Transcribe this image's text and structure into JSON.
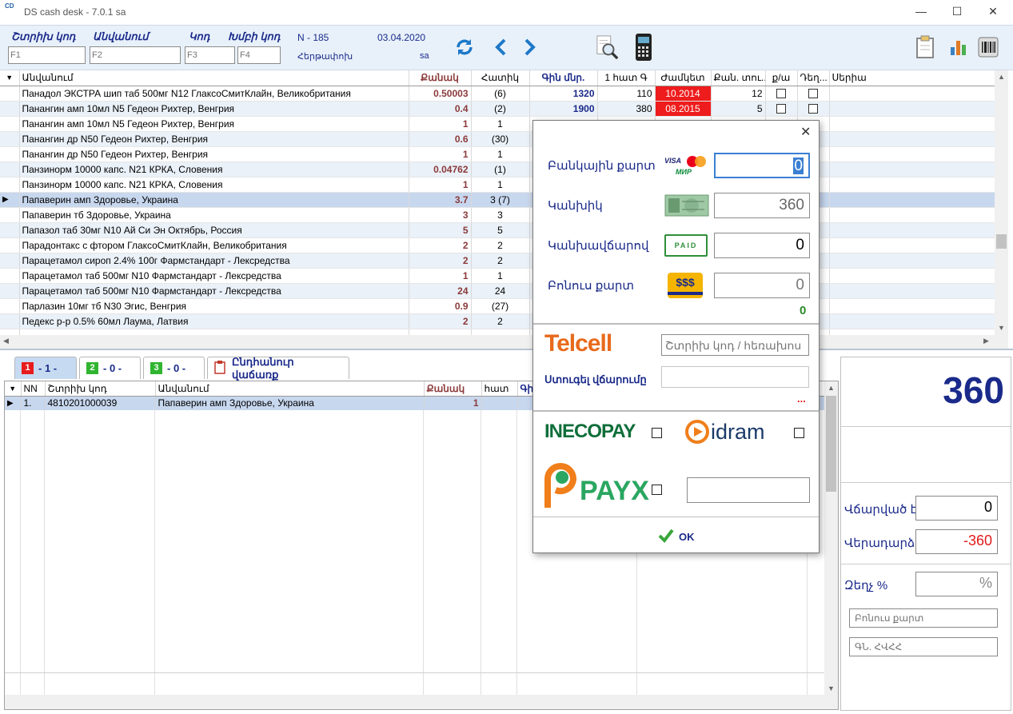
{
  "window": {
    "title": "DS cash desk - 7.0.1 sa",
    "logo": "CD",
    "minimize": "—",
    "maximize": "☐",
    "close": "✕"
  },
  "search": {
    "barcode_label": "Շտրիխ կոդ",
    "barcode_placeholder": "F1",
    "name_label": "Անվանում",
    "name_placeholder": "F2",
    "code_label": "Կոդ",
    "code_placeholder": "F3",
    "group_label": "Խմբի կոդ",
    "group_placeholder": "F4"
  },
  "doc": {
    "number": "N - 185",
    "date": "03.04.2020",
    "kind": "Հերթափոխ",
    "user": "sa"
  },
  "icons": {
    "refresh": "refresh-icon",
    "prev": "chevron-left-icon",
    "next": "chevron-right-icon",
    "search": "magnifier-icon",
    "terminal": "pos-terminal-icon",
    "clipboard": "clipboard-icon",
    "chart": "bar-chart-icon",
    "barcode": "barcode-icon"
  },
  "grid": {
    "columns": [
      "Անվանում",
      "Քանակ",
      "Հատիկ",
      "Գին մնր.",
      "1 հատ Գ",
      "Ժամկետ",
      "Քան. տու...",
      "ք/ա",
      "Դեղ...",
      "Սերիա"
    ],
    "rows": [
      {
        "name": "Панадол ЭКСТРА шип таб 500мг N12  ГлаксоСмитКлайн, Великобритания",
        "qty": "0.50003",
        "pcs": "(6)",
        "price": "1320",
        "unit": "110",
        "expiry": "10.2014",
        "pack": "12",
        "expired": true
      },
      {
        "name": "Панангин амп 10мл N5  Гедеон Рихтер, Венгрия",
        "qty": "0.4",
        "pcs": "(2)",
        "price": "1900",
        "unit": "380",
        "expiry": "08.2015",
        "pack": "5",
        "expired": true
      },
      {
        "name": "Панангин амп 10мл N5  Гедеон Рихтер, Венгрия",
        "qty": "1",
        "pcs": "1",
        "price": "",
        "unit": "",
        "expiry": "",
        "pack": "",
        "expired": false
      },
      {
        "name": "Панангин др N50  Гедеон Рихтер, Венгрия",
        "qty": "0.6",
        "pcs": "(30)",
        "price": "",
        "unit": "",
        "expiry": "",
        "pack": "",
        "expired": false
      },
      {
        "name": "Панангин др N50  Гедеон Рихтер, Венгрия",
        "qty": "1",
        "pcs": "1",
        "price": "",
        "unit": "",
        "expiry": "",
        "pack": "",
        "expired": false
      },
      {
        "name": "Панзинорм 10000 капс. N21  КРКА, Словения",
        "qty": "0.04762",
        "pcs": "(1)",
        "price": "",
        "unit": "",
        "expiry": "",
        "pack": "",
        "expired": false
      },
      {
        "name": "Панзинорм 10000 капс. N21  КРКА, Словения",
        "qty": "1",
        "pcs": "1",
        "price": "",
        "unit": "",
        "expiry": "",
        "pack": "",
        "expired": false
      },
      {
        "name": "Папаверин амп  Здоровье, Украина",
        "qty": "3.7",
        "pcs": "3 (7)",
        "price": "",
        "unit": "",
        "expiry": "",
        "pack": "",
        "expired": false
      },
      {
        "name": "Папаверин тб   Здоровье, Украина",
        "qty": "3",
        "pcs": "3",
        "price": "",
        "unit": "",
        "expiry": "",
        "pack": "",
        "expired": false
      },
      {
        "name": "Папазол таб 30мг N10  Ай Си Эн Октябрь, Россия",
        "qty": "5",
        "pcs": "5",
        "price": "",
        "unit": "",
        "expiry": "",
        "pack": "",
        "expired": false
      },
      {
        "name": "Парадонтакс с фтором  ГлаксоСмитКлайн, Великобритания",
        "qty": "2",
        "pcs": "2",
        "price": "",
        "unit": "",
        "expiry": "",
        "pack": "",
        "expired": false
      },
      {
        "name": "Парацетамол сироп 2.4% 100г  Фармстандарт - Лексредства",
        "qty": "2",
        "pcs": "2",
        "price": "",
        "unit": "",
        "expiry": "",
        "pack": "",
        "expired": false
      },
      {
        "name": "Парацетамол таб 500мг N10  Фармстандарт - Лексредства",
        "qty": "1",
        "pcs": "1",
        "price": "",
        "unit": "",
        "expiry": "",
        "pack": "",
        "expired": false
      },
      {
        "name": "Парацетамол таб 500мг N10  Фармстандарт - Лексредства",
        "qty": "24",
        "pcs": "24",
        "price": "",
        "unit": "",
        "expiry": "",
        "pack": "",
        "expired": false
      },
      {
        "name": "Парлазин 10мг тб N30  Эгис, Венгрия",
        "qty": "0.9",
        "pcs": "(27)",
        "price": "",
        "unit": "",
        "expiry": "",
        "pack": "",
        "expired": false
      },
      {
        "name": "Педекс р-р 0.5% 60мл  Лаума, Латвия",
        "qty": "2",
        "pcs": "2",
        "price": "",
        "unit": "",
        "expiry": "",
        "pack": "",
        "expired": false
      }
    ],
    "selected_row": 7
  },
  "tabs": [
    {
      "num": "1",
      "label": "- 1 -",
      "color": "#e81c1c"
    },
    {
      "num": "2",
      "label": "- 0 -",
      "color": "#2fb52f"
    },
    {
      "num": "3",
      "label": "- 0 -",
      "color": "#2fb52f"
    },
    {
      "num": "",
      "label": "Ընդհանուր վաճառք",
      "color": ""
    }
  ],
  "cart": {
    "columns": [
      "NN",
      "Շտրիխ կոդ",
      "Անվանում",
      "Քանակ",
      "հատ",
      "Գի"
    ],
    "rows": [
      {
        "nn": "1.",
        "barcode": "4810201000039",
        "name": "Папаверин амп  Здоровье, Украина",
        "qty": "1"
      }
    ]
  },
  "summary": {
    "total": "360",
    "paid_label": "Վճարված է",
    "paid_value": "0",
    "change_label": "Վերադարձ",
    "change_value": "-360",
    "discount_label": "Զեղչ %",
    "discount_value": "%",
    "bonus_placeholder": "Բոնուս քարտ",
    "tax_placeholder": "ԳՆ. ՀՎՀՀ"
  },
  "payment_dialog": {
    "close": "✕",
    "card_label": "Բանկային քարտ",
    "card_value": "0",
    "card_brands": [
      "VISA",
      "МИР"
    ],
    "cash_label": "Կանխիկ",
    "cash_value": "360",
    "prepaid_label": "Կանխավճարով",
    "prepaid_value": "0",
    "prepaid_badge": "PAID",
    "bonus_label": "Բոնուս քարտ",
    "bonus_value": "0",
    "bonus_badge": "$$$",
    "remaining": "0",
    "telcell_logo": "Telcell",
    "telcell_placeholder": "Շտրիխ կոդ / հեռախոս",
    "telcell_send_label": "Ստուգել վճարումը",
    "dots": "...",
    "inecopay": "INECOPAY",
    "idram": "idram",
    "payx": "PAYX",
    "ok": "OK"
  }
}
